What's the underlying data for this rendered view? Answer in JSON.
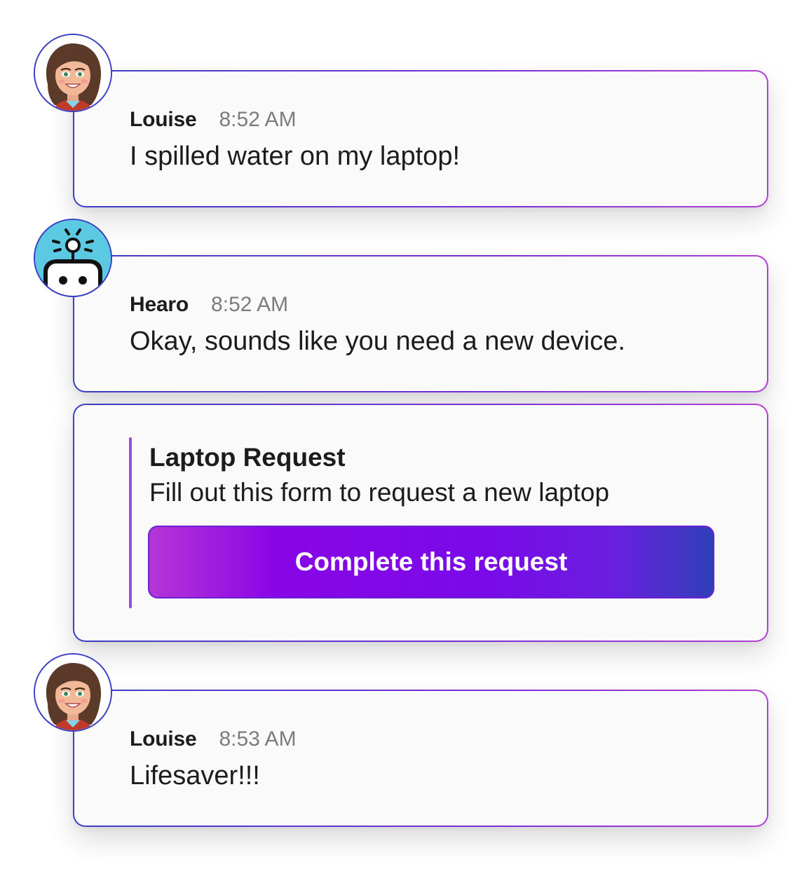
{
  "messages": [
    {
      "sender": "Louise",
      "time": "8:52 AM",
      "text": "I spilled water on my laptop!",
      "avatar": "woman-avatar-icon"
    },
    {
      "sender": "Hearo",
      "time": "8:52 AM",
      "text": "Okay, sounds like you need a new device.",
      "avatar": "robot-avatar-icon"
    },
    {
      "sender": "Louise",
      "time": "8:53 AM",
      "text": "Lifesaver!!!",
      "avatar": "woman-avatar-icon"
    }
  ],
  "attachment": {
    "title": "Laptop Request",
    "description": "Fill out this form to request a new laptop",
    "button_label": "Complete this request"
  },
  "colors": {
    "border_start": "#3a3fc4",
    "border_end": "#b13fd4",
    "accent_bar": "#9b4bd8",
    "button_gradient": [
      "#b536d6",
      "#8a06e6",
      "#2f3fb8"
    ],
    "robot_avatar_bg": "#5cc9e2"
  }
}
